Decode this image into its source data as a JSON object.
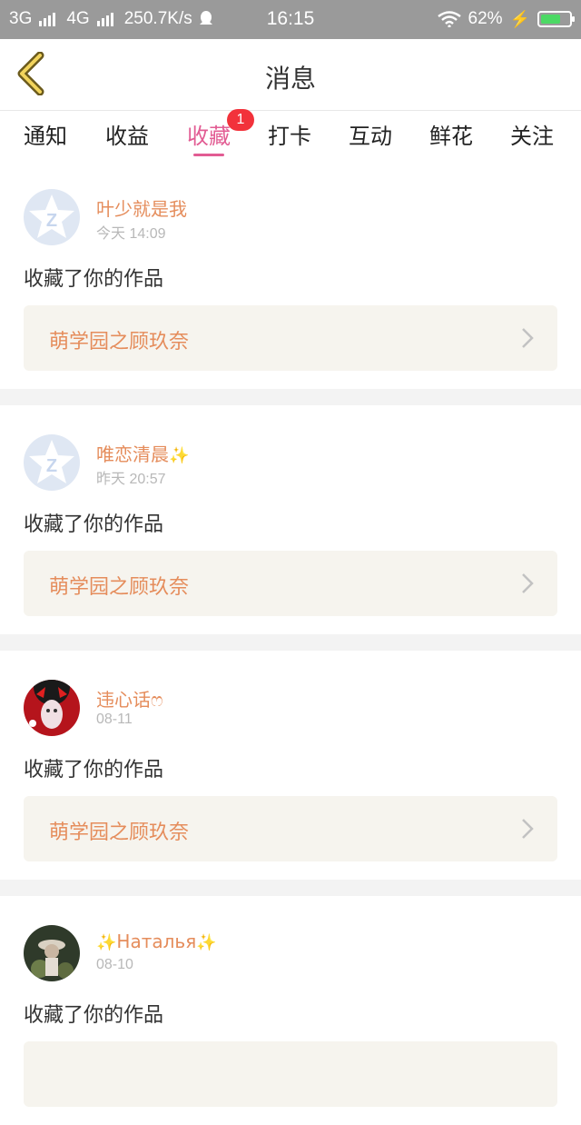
{
  "status_bar": {
    "network1": "3G",
    "network2": "4G",
    "speed": "250.7K/s",
    "time": "16:15",
    "battery": "62%",
    "battery_level": 0.62
  },
  "header": {
    "title": "消息"
  },
  "tabs": [
    {
      "label": "通知"
    },
    {
      "label": "收益"
    },
    {
      "label": "收藏",
      "active": true,
      "badge": "1"
    },
    {
      "label": "打卡"
    },
    {
      "label": "互动"
    },
    {
      "label": "鲜花"
    },
    {
      "label": "关注"
    }
  ],
  "messages": [
    {
      "user": "叶少就是我",
      "time": "今天 14:09",
      "action": "收藏了你的作品",
      "work": "萌学园之顾玖奈"
    },
    {
      "user": "唯恋清晨",
      "time": "昨天 20:57",
      "action": "收藏了你的作品",
      "work": "萌学园之顾玖奈"
    },
    {
      "user": "违心话ෆ",
      "time": "08-11",
      "action": "收藏了你的作品",
      "work": "萌学园之顾玖奈"
    },
    {
      "user": "Наталья",
      "time": "08-10",
      "action": "收藏了你的作品",
      "work": ""
    }
  ],
  "colors": {
    "accent": "#e25c93",
    "username": "#e58d5c",
    "badge": "#f2323b"
  }
}
